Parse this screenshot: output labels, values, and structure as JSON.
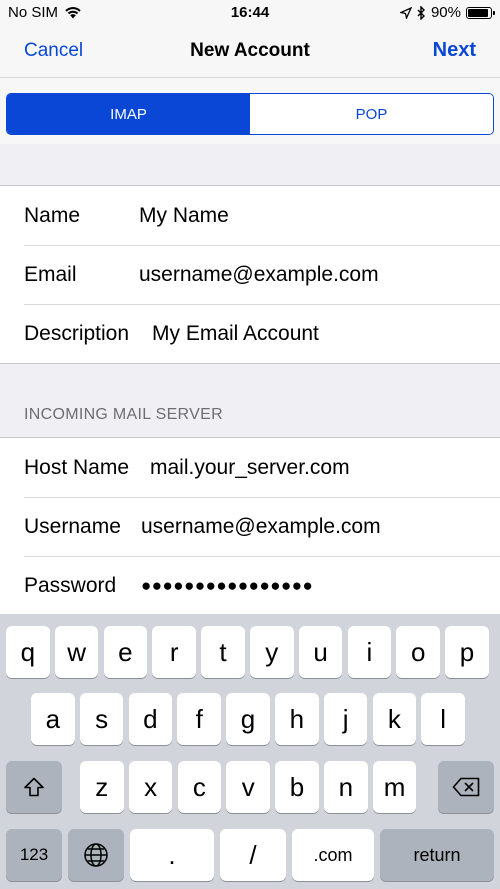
{
  "status_bar": {
    "carrier": "No SIM",
    "time": "16:44",
    "battery": "90%",
    "battery_level": 0.9
  },
  "nav": {
    "cancel": "Cancel",
    "title": "New Account",
    "next": "Next"
  },
  "segments": {
    "imap": "IMAP",
    "pop": "POP",
    "selected": "IMAP"
  },
  "account": {
    "name_label": "Name",
    "name_value": "My Name",
    "email_label": "Email",
    "email_value": "username@example.com",
    "description_label": "Description",
    "description_value": "My Email Account"
  },
  "incoming": {
    "header": "INCOMING MAIL SERVER",
    "host_label": "Host Name",
    "host_value": "mail.your_server.com",
    "username_label": "Username",
    "username_value": "username@example.com",
    "password_label": "Password",
    "password_value": "●●●●●●●●●●●●●●●●"
  },
  "keyboard": {
    "row1": [
      "q",
      "w",
      "e",
      "r",
      "t",
      "y",
      "u",
      "i",
      "o",
      "p"
    ],
    "row2": [
      "a",
      "s",
      "d",
      "f",
      "g",
      "h",
      "j",
      "k",
      "l"
    ],
    "row3": [
      "z",
      "x",
      "c",
      "v",
      "b",
      "n",
      "m"
    ],
    "numbers": "123",
    "dot": ".",
    "slash": "/",
    "dotcom": ".com",
    "return": "return"
  },
  "colors": {
    "accent": "#0a47d6",
    "background": "#efeff4"
  }
}
